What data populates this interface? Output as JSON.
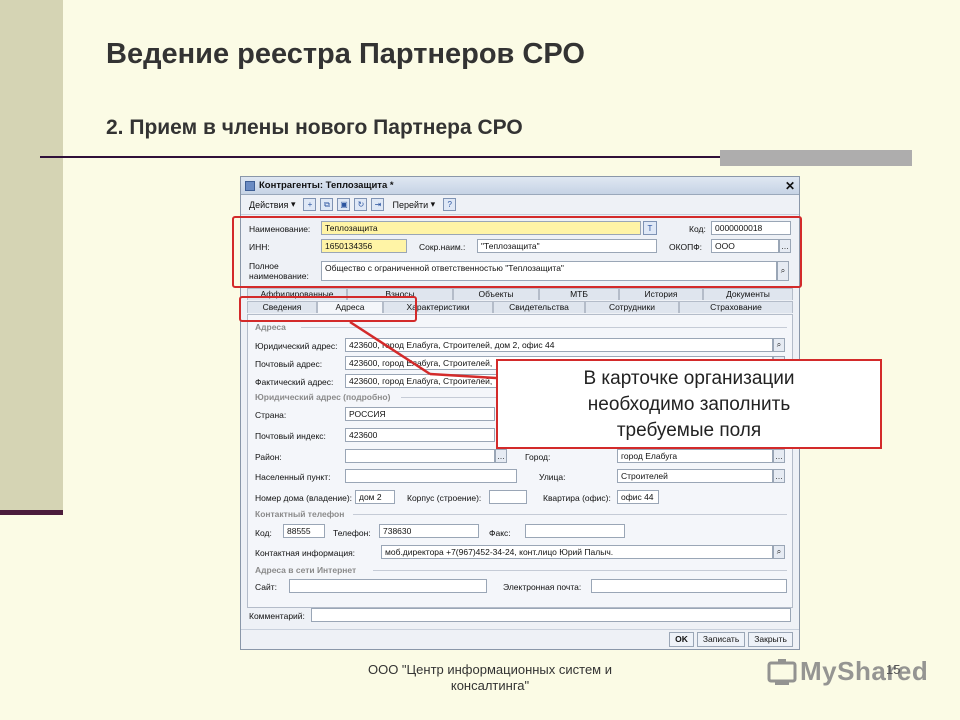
{
  "slide": {
    "title": "Ведение реестра Партнеров СРО",
    "subtitle": "2. Прием в члены нового Партнера СРО",
    "footer_line1": "ООО \"Центр информационных систем и",
    "footer_line2": "консалтинга\"",
    "page_number": "15",
    "watermark": "MyShared"
  },
  "window": {
    "title": "Контрагенты: Теплозащита *",
    "close_glyph": "✕",
    "toolbar": {
      "actions": "Действия",
      "goto": "Перейти",
      "help": "?"
    },
    "header": {
      "name_label": "Наименование:",
      "name_value": "Теплозащита",
      "code_label": "Код:",
      "code_value": "0000000018",
      "inn_label": "ИНН:",
      "inn_value": "1650134356",
      "short_label": "Сокр.наим.:",
      "short_value": "\"Теплозащита\"",
      "okopf_label": "ОКОПФ:",
      "okopf_value": "ООО",
      "full_label_1": "Полное",
      "full_label_2": "наименование:",
      "full_value": "Общество с ограниченной ответственностью \"Теплозащита\""
    },
    "tabs_row1": [
      "Аффилированные",
      "Взносы",
      "Объекты",
      "МТБ",
      "История",
      "Документы"
    ],
    "tabs_row2": [
      "Сведения",
      "Адреса",
      "Характеристики",
      "Свидетельства",
      "Сотрудники",
      "Страхование"
    ],
    "addresses": {
      "group_title": "Адреса",
      "legal_label": "Юридический адрес:",
      "legal_value": "423600, город Елабуга, Строителей, дом 2, офис 44",
      "postal_label": "Почтовый адрес:",
      "postal_value": "423600, город Елабуга, Строителей,",
      "actual_label": "Фактический адрес:",
      "actual_value": "423600, город Елабуга, Строителей,",
      "detail_title": "Юридический адрес (подробно)",
      "country_label": "Страна:",
      "country_value": "РОССИЯ",
      "zip_label": "Почтовый индекс:",
      "zip_value": "423600",
      "district_label": "Район:",
      "city_label": "Город:",
      "city_value": "город Елабуга",
      "locality_label": "Населенный пункт:",
      "street_label": "Улица:",
      "street_value": "Строителей",
      "house_label": "Номер дома (владение):",
      "house_value": "дом 2",
      "building_label": "Корпус (строение):",
      "flat_label": "Квартира (офис):",
      "flat_value": "офис 44"
    },
    "phone": {
      "group_title": "Контактный телефон",
      "code_label": "Код:",
      "code_value": "88555",
      "phone_label": "Телефон:",
      "phone_value": "738630",
      "fax_label": "Факс:",
      "contact_label": "Контактная информация:",
      "contact_value": "моб.директора +7(967)452-34-24, конт.лицо Юрий Палыч."
    },
    "internet": {
      "group_title": "Адреса в сети Интернет",
      "site_label": "Сайт:",
      "email_label": "Электронная почта:"
    },
    "comment_label": "Комментарий:",
    "buttons": {
      "ok": "OK",
      "save": "Записать",
      "close": "Закрыть"
    }
  },
  "callout": {
    "line1": "В карточке организации",
    "line2": "необходимо заполнить",
    "line3": "требуемые поля"
  },
  "colors": {
    "highlight": "#d32a2a",
    "slide_bg": "#fbfbe5",
    "required_field": "#fff4a6"
  }
}
